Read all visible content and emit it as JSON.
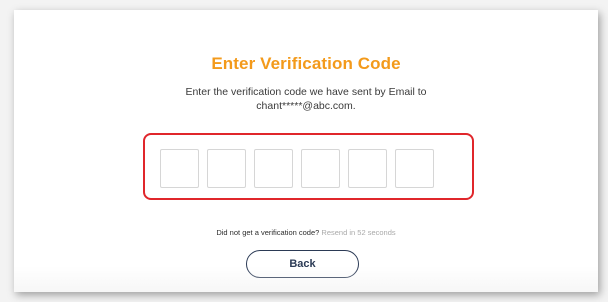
{
  "heading": "Enter Verification Code",
  "instruction_line1": "Enter the verification code we have sent by Email to",
  "instruction_line2": "chant*****@abc.com.",
  "code_inputs": [
    "",
    "",
    "",
    "",
    "",
    ""
  ],
  "resend": {
    "question": "Did not get a verification code?",
    "countdown": "Resend in 52 seconds"
  },
  "back_label": "Back",
  "colors": {
    "accent": "#f39a1b",
    "highlight": "#e0262b",
    "button_border": "#2b3a55"
  }
}
